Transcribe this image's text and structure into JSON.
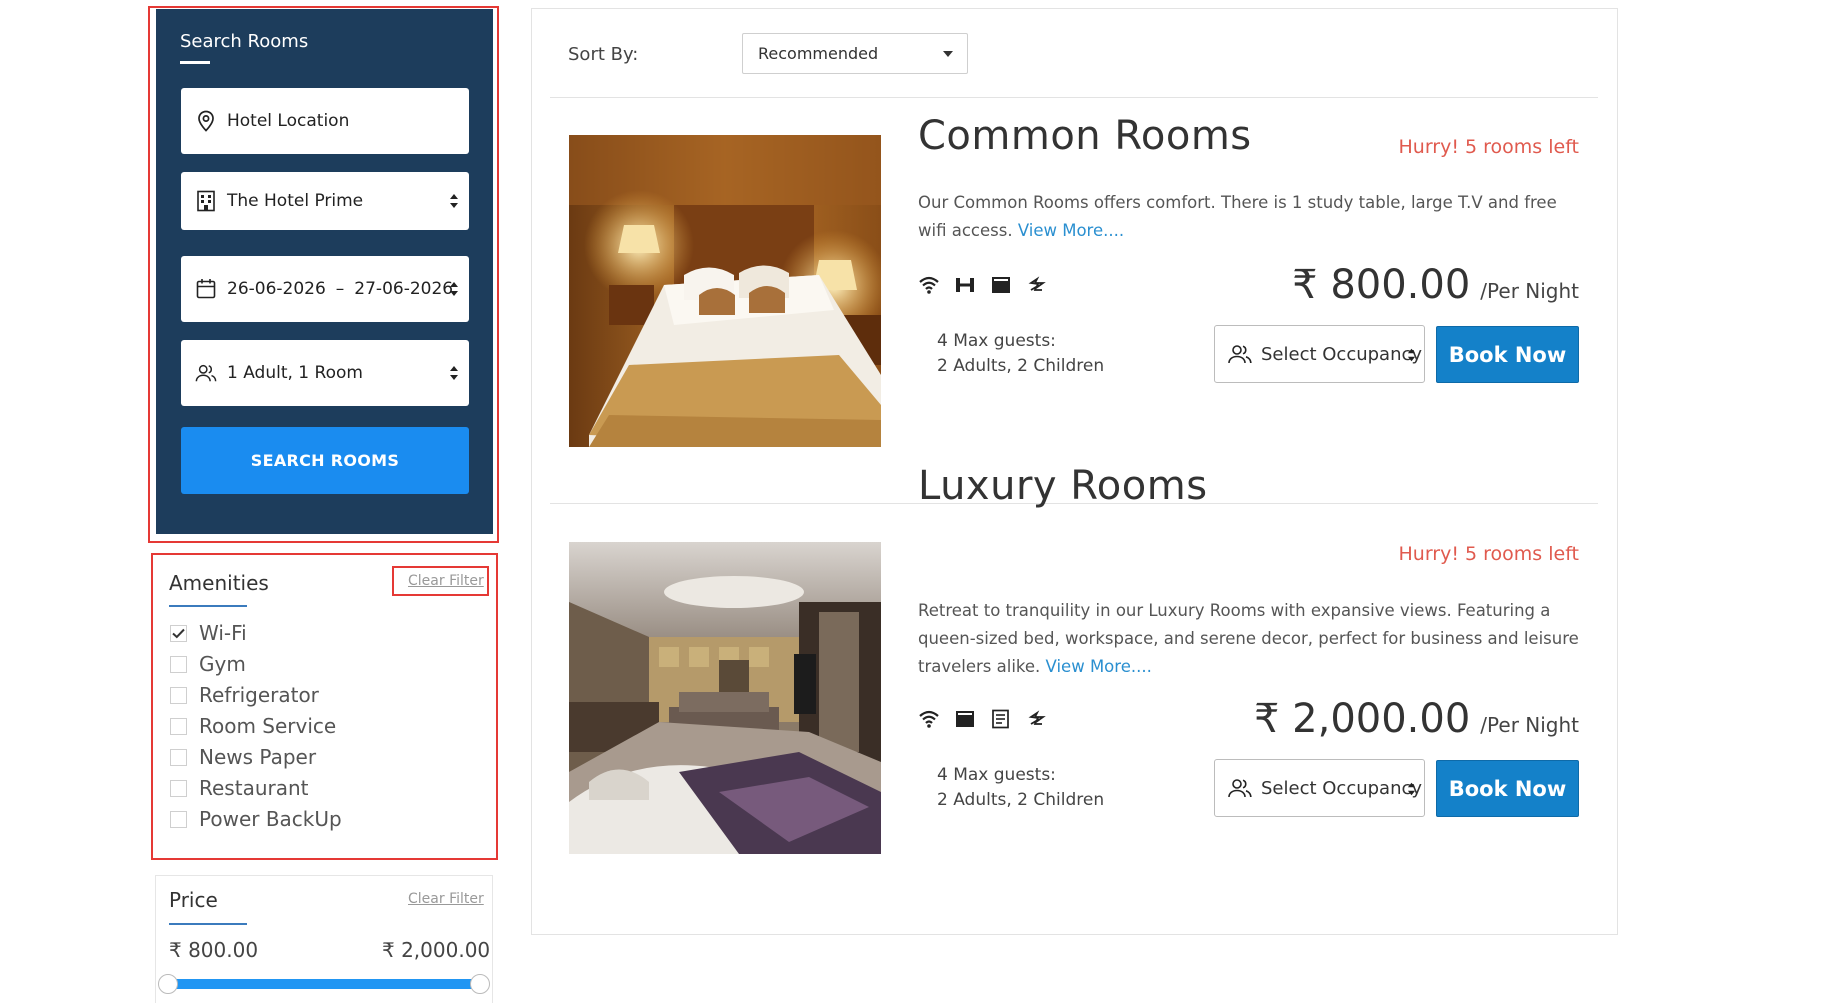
{
  "search": {
    "title": "Search Rooms",
    "location_placeholder": "Hotel Location",
    "hotel": "The Hotel Prime",
    "check_in": "26-06-2026",
    "date_separator": "–",
    "check_out": "27-06-2026",
    "occupancy": "1 Adult, 1 Room",
    "button": "SEARCH ROOMS",
    "icons": [
      "location-pin-icon",
      "building-icon",
      "calendar-icon",
      "users-icon"
    ]
  },
  "amenities": {
    "title": "Amenities",
    "clear": "Clear Filter",
    "items": [
      {
        "label": "Wi-Fi",
        "checked": true
      },
      {
        "label": "Gym",
        "checked": false
      },
      {
        "label": "Refrigerator",
        "checked": false
      },
      {
        "label": "Room Service",
        "checked": false
      },
      {
        "label": "News Paper",
        "checked": false
      },
      {
        "label": "Restaurant",
        "checked": false
      },
      {
        "label": "Power BackUp",
        "checked": false
      }
    ]
  },
  "price_filter": {
    "title": "Price",
    "clear": "Clear Filter",
    "min": "₹ 800.00",
    "max": "₹ 2,000.00",
    "range_fraction": [
      0,
      1
    ]
  },
  "sort": {
    "label": "Sort By:",
    "value": "Recommended"
  },
  "rooms": [
    {
      "name": "Common Rooms",
      "availability": "Hurry! 5 rooms left",
      "description": "Our Common Rooms offers comfort. There is 1 study table, large T.V and free wifi access.",
      "view_more": "View More....",
      "amenity_icons": [
        "wifi-icon",
        "gym-icon",
        "refrigerator-icon",
        "power-icon"
      ],
      "price": "₹ 800.00",
      "per": "/Per Night",
      "guests_line1": "4 Max guests:",
      "guests_line2": "2 Adults, 2 Children",
      "occupancy_select": "Select Occupancy",
      "book": "Book Now"
    },
    {
      "name": "Luxury Rooms",
      "availability": "Hurry! 5 rooms left",
      "description": "Retreat to tranquility in our Luxury Rooms with expansive views. Featuring a queen-sized bed, workspace, and serene decor, perfect for business and leisure travelers alike.",
      "view_more": "View More....",
      "amenity_icons": [
        "wifi-icon",
        "refrigerator-icon",
        "newspaper-icon",
        "power-icon"
      ],
      "price": "₹ 2,000.00",
      "per": "/Per Night",
      "guests_line1": "4 Max guests:",
      "guests_line2": "2 Adults, 2 Children",
      "occupancy_select": "Select Occupancy",
      "book": "Book Now"
    }
  ],
  "colors": {
    "search_panel": "#1d3d5c",
    "search_button": "#1a8cf0",
    "book_button": "#1481c9",
    "highlight_border": "#e53935",
    "hurry_text": "#e05a4e",
    "link": "#2a8fd0"
  }
}
